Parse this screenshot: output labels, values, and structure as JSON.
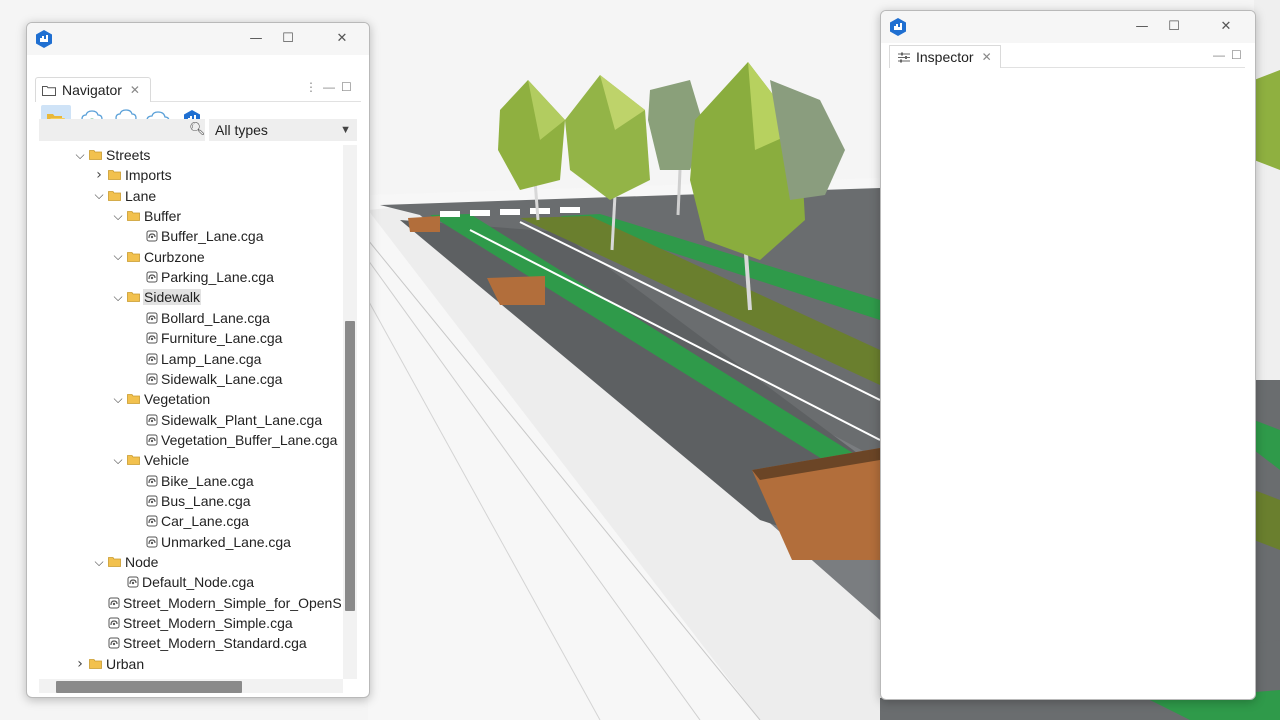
{
  "navigator": {
    "tab_label": "Navigator",
    "filter": {
      "placeholder": "",
      "type_select": "All types"
    },
    "tree": [
      {
        "id": "streets",
        "label": "Streets",
        "level": 0,
        "kind": "folder",
        "expanded": true
      },
      {
        "id": "imports",
        "label": "Imports",
        "level": 1,
        "kind": "folder",
        "expanded": false
      },
      {
        "id": "lane",
        "label": "Lane",
        "level": 1,
        "kind": "folder",
        "expanded": true
      },
      {
        "id": "buffer",
        "label": "Buffer",
        "level": 2,
        "kind": "folder",
        "expanded": true
      },
      {
        "id": "buffer-lane",
        "label": "Buffer_Lane.cga",
        "level": 3,
        "kind": "file"
      },
      {
        "id": "curbzone",
        "label": "Curbzone",
        "level": 2,
        "kind": "folder",
        "expanded": true
      },
      {
        "id": "parking-lane",
        "label": "Parking_Lane.cga",
        "level": 3,
        "kind": "file"
      },
      {
        "id": "sidewalk",
        "label": "Sidewalk",
        "level": 2,
        "kind": "folder",
        "expanded": true,
        "selected": true
      },
      {
        "id": "bollard-lane",
        "label": "Bollard_Lane.cga",
        "level": 3,
        "kind": "file"
      },
      {
        "id": "furniture-lane",
        "label": "Furniture_Lane.cga",
        "level": 3,
        "kind": "file"
      },
      {
        "id": "lamp-lane",
        "label": "Lamp_Lane.cga",
        "level": 3,
        "kind": "file"
      },
      {
        "id": "sidewalk-lane",
        "label": "Sidewalk_Lane.cga",
        "level": 3,
        "kind": "file"
      },
      {
        "id": "vegetation",
        "label": "Vegetation",
        "level": 2,
        "kind": "folder",
        "expanded": true
      },
      {
        "id": "sidewalk-plant-lane",
        "label": "Sidewalk_Plant_Lane.cga",
        "level": 3,
        "kind": "file"
      },
      {
        "id": "vegetation-buffer-lane",
        "label": "Vegetation_Buffer_Lane.cga",
        "level": 3,
        "kind": "file"
      },
      {
        "id": "vehicle",
        "label": "Vehicle",
        "level": 2,
        "kind": "folder",
        "expanded": true
      },
      {
        "id": "bike-lane",
        "label": "Bike_Lane.cga",
        "level": 3,
        "kind": "file"
      },
      {
        "id": "bus-lane",
        "label": "Bus_Lane.cga",
        "level": 3,
        "kind": "file"
      },
      {
        "id": "car-lane",
        "label": "Car_Lane.cga",
        "level": 3,
        "kind": "file"
      },
      {
        "id": "unmarked-lane",
        "label": "Unmarked_Lane.cga",
        "level": 3,
        "kind": "file"
      },
      {
        "id": "node",
        "label": "Node",
        "level": 1,
        "kind": "folder",
        "expanded": true
      },
      {
        "id": "default-node",
        "label": "Default_Node.cga",
        "level": 2,
        "kind": "file"
      },
      {
        "id": "street-modern-simple-osm",
        "label": "Street_Modern_Simple_for_OpenSt",
        "level": 1,
        "kind": "file"
      },
      {
        "id": "street-modern-simple",
        "label": "Street_Modern_Simple.cga",
        "level": 1,
        "kind": "file"
      },
      {
        "id": "street-modern-standard",
        "label": "Street_Modern_Standard.cga",
        "level": 1,
        "kind": "file"
      },
      {
        "id": "urban",
        "label": "Urban",
        "level": 0,
        "kind": "folder",
        "expanded": false
      }
    ],
    "toolbar_icons": [
      "open-folder-icon",
      "cloud-upload-icon",
      "cloud-share-icon",
      "cloud-icon",
      "cityengine-icon"
    ]
  },
  "inspector": {
    "tab_label": "Inspector"
  },
  "colors": {
    "accent": "#1f6fd1",
    "bike_lane": "#2f9a4a",
    "road": "#6b6e70",
    "grass": "#6a7f2e",
    "tree_light": "#a6c24e",
    "tree_sage": "#8aa07a",
    "planter": "#b26e3b"
  }
}
